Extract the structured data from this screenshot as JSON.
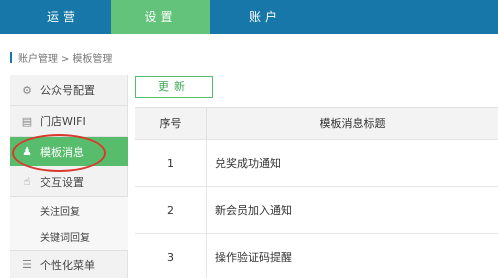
{
  "top_nav": {
    "tabs": [
      {
        "label": "运营"
      },
      {
        "label": "设置",
        "active": true
      },
      {
        "label": "账户"
      }
    ]
  },
  "breadcrumb": {
    "parent": "账户管理",
    "separator": ">",
    "current": "模板管理"
  },
  "sidebar": {
    "items": [
      {
        "label": "公众号配置",
        "icon": "gear-icon"
      },
      {
        "label": "门店WIFI",
        "icon": "calendar-icon"
      },
      {
        "label": "模板消息",
        "icon": "user-icon",
        "active": true
      },
      {
        "label": "交互设置",
        "icon": "hand-icon"
      },
      {
        "label": "关注回复"
      },
      {
        "label": "关键词回复"
      },
      {
        "label": "个性化菜单",
        "icon": "menu-icon"
      }
    ]
  },
  "toolbar": {
    "update_label": "更新"
  },
  "table": {
    "headers": {
      "seq": "序号",
      "title": "模板消息标题"
    },
    "rows": [
      {
        "seq": "1",
        "title": "兑奖成功通知"
      },
      {
        "seq": "2",
        "title": "新会员加入通知"
      },
      {
        "seq": "3",
        "title": "操作验证码提醒"
      }
    ]
  },
  "colors": {
    "nav_blue": "#1677a8",
    "accent_green": "#57bd6c",
    "highlight_red": "#d9392c"
  }
}
